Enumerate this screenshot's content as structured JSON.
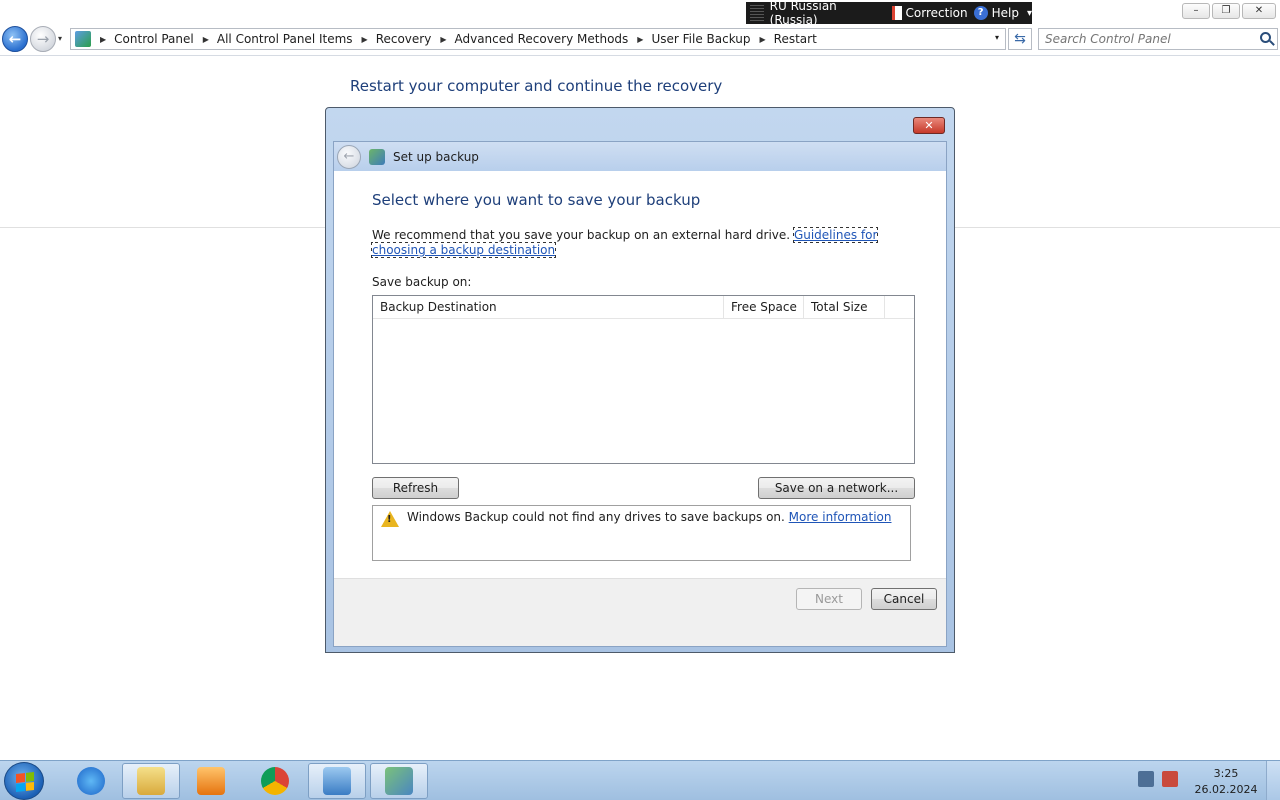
{
  "langbar": {
    "language": "RU Russian (Russia)",
    "correction": "Correction",
    "help": "Help",
    "help_glyph": "?",
    "options_glyph": "▾"
  },
  "caption_buttons": {
    "minimize": "–",
    "restore": "❐",
    "close": "✕"
  },
  "navigation": {
    "back_glyph": "←",
    "forward_glyph": "→",
    "dropdown_glyph": "▾",
    "refresh_glyph": "⇆",
    "breadcrumbs": [
      "Control Panel",
      "All Control Panel Items",
      "Recovery",
      "Advanced Recovery Methods",
      "User File Backup",
      "Restart"
    ],
    "crumb_separator": "▶",
    "search_placeholder": "Search Control Panel"
  },
  "page": {
    "heading": "Restart your computer and continue the recovery"
  },
  "dialog": {
    "close_glyph": "✕",
    "back_glyph": "←",
    "title": "Set up backup",
    "heading": "Select where you want to save your backup",
    "recommendation": "We recommend that you save your backup on an external hard drive.",
    "guidelines_link": "Guidelines for choosing a backup destination",
    "save_on_label": "Save backup on:",
    "columns": [
      "Backup Destination",
      "Free Space",
      "Total Size"
    ],
    "rows": [],
    "refresh_button": "Refresh",
    "network_button": "Save on a network...",
    "warning_glyph": "!",
    "warning_text": "Windows Backup could not find any drives to save backups on.",
    "more_info_link": "More information",
    "next_button": "Next",
    "cancel_button": "Cancel"
  },
  "taskbar": {
    "items": [
      "internet-explorer",
      "windows-explorer",
      "media-player",
      "chrome",
      "control-panel",
      "backup-and-restore"
    ],
    "clock_time": "3:25",
    "clock_date": "26.02.2024"
  },
  "colors": {
    "heading_blue": "#1e3f7a",
    "link_blue": "#1f55b7",
    "taskbar_top": "#bcd5ee",
    "warning_yellow": "#e9b520"
  }
}
